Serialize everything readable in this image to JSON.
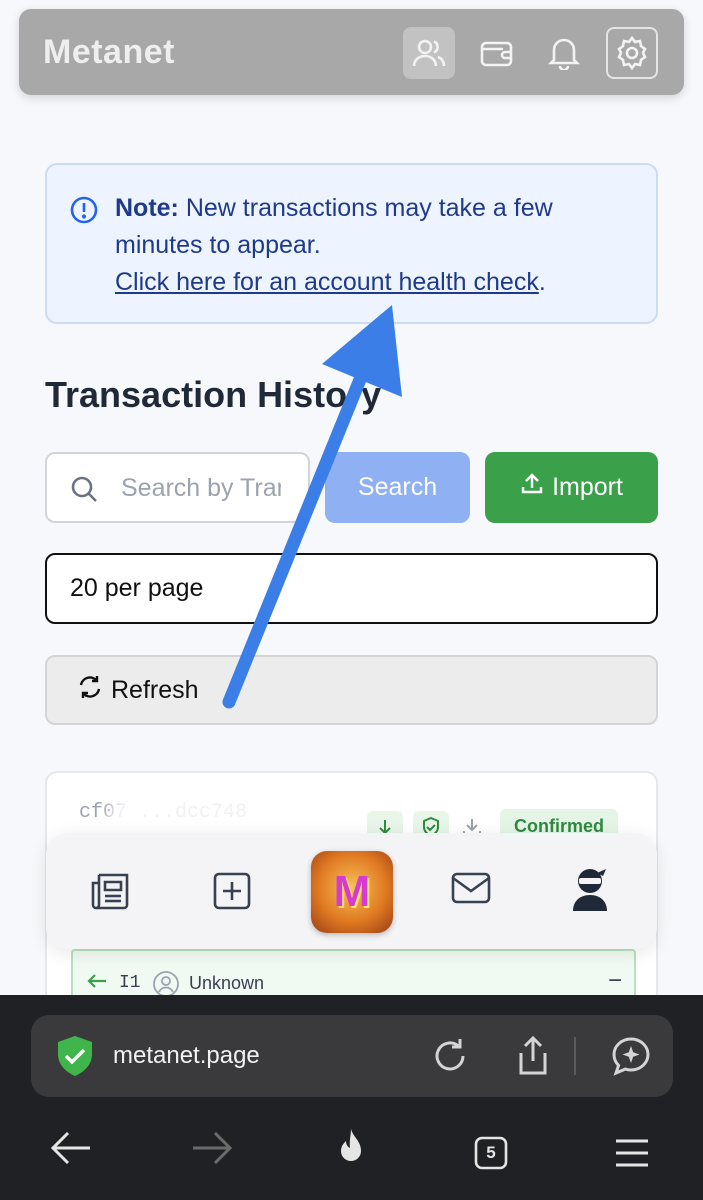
{
  "header": {
    "brand": "Metanet",
    "icons": [
      "people-icon",
      "wallet-icon",
      "bell-icon",
      "gear-icon"
    ]
  },
  "note": {
    "label": "Note:",
    "text": " New transactions may take a few minutes to appear.",
    "link": "Click here for an account health check",
    "link_suffix": "."
  },
  "page_title": "Transaction History",
  "search": {
    "placeholder": "Search by Transaction ID",
    "button_label": "Search",
    "import_label": "Import"
  },
  "per_page": {
    "value": "20 per page"
  },
  "refresh_label": "Refresh",
  "transaction": {
    "txid": "cf07         ...dcc748",
    "status": "Confirmed",
    "input_label": "I1",
    "input_name": "Unknown"
  },
  "dock": {
    "items": [
      "news-icon",
      "add-square-icon",
      "metanet-app-icon",
      "mail-icon",
      "ninja-avatar-icon"
    ]
  },
  "browser": {
    "url": "metanet.page",
    "tab_count": "5"
  },
  "colors": {
    "accent_blue": "#3b82f6",
    "import_green": "#3aa14a",
    "status_green": "#2f8a3f",
    "note_text": "#1e3a8a"
  }
}
